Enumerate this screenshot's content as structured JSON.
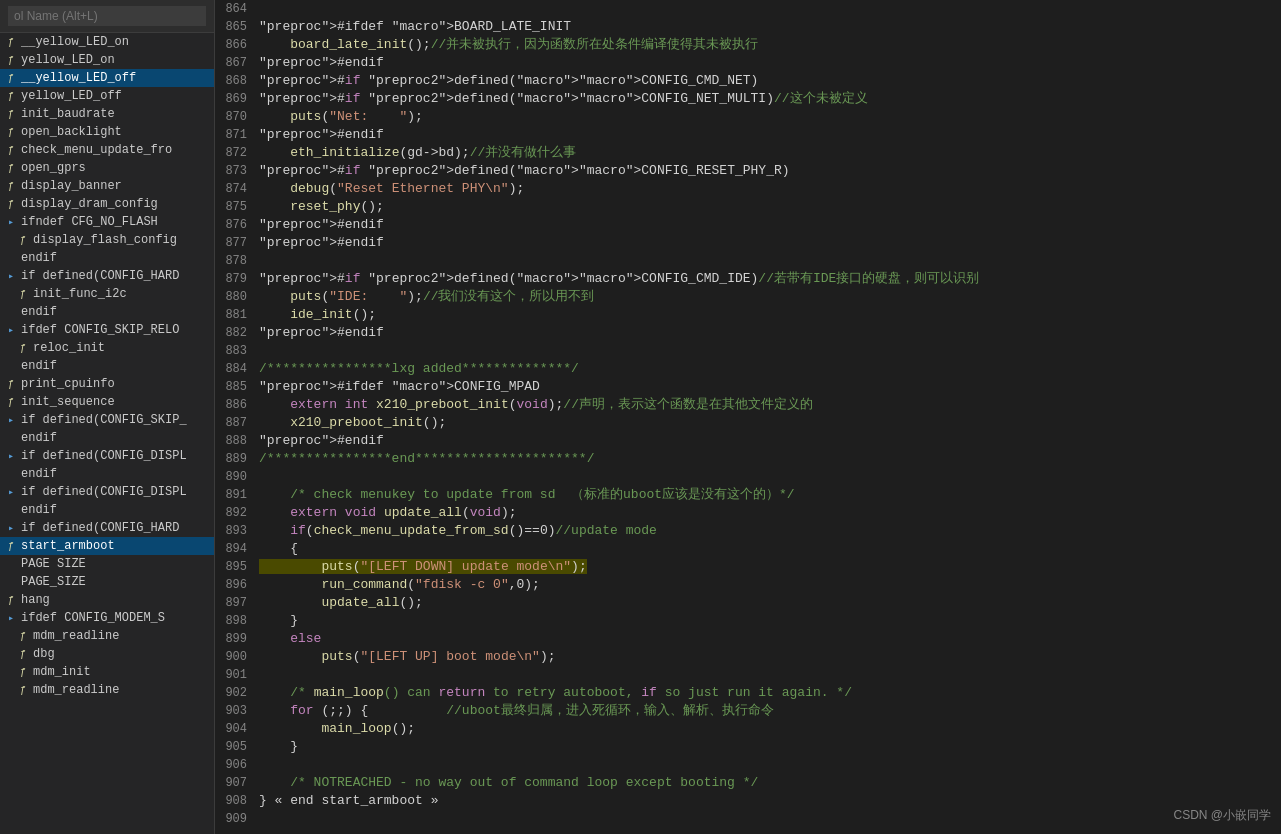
{
  "sidebar": {
    "search_placeholder": "ol Name (Alt+L)",
    "items": [
      {
        "label": "__yellow_LED_on",
        "indent": 0,
        "type": "func",
        "active": false
      },
      {
        "label": "yellow_LED_on",
        "indent": 0,
        "type": "func",
        "active": false
      },
      {
        "label": "__yellow_LED_off",
        "indent": 0,
        "type": "func",
        "active": false,
        "selected": true
      },
      {
        "label": "yellow_LED_off",
        "indent": 0,
        "type": "func",
        "active": false
      },
      {
        "label": "init_baudrate",
        "indent": 0,
        "type": "func",
        "active": false
      },
      {
        "label": "open_backlight",
        "indent": 0,
        "type": "func",
        "active": false
      },
      {
        "label": "check_menu_update_fro",
        "indent": 0,
        "type": "func",
        "active": false
      },
      {
        "label": "open_gprs",
        "indent": 0,
        "type": "func",
        "active": false
      },
      {
        "label": "display_banner",
        "indent": 0,
        "type": "func",
        "active": false
      },
      {
        "label": "display_dram_config",
        "indent": 0,
        "type": "func",
        "active": false
      },
      {
        "label": "ifndef CFG_NO_FLASH",
        "indent": 0,
        "type": "group",
        "active": false
      },
      {
        "label": "display_flash_config",
        "indent": 1,
        "type": "func",
        "active": false
      },
      {
        "label": "endif",
        "indent": 0,
        "type": "kw",
        "active": false
      },
      {
        "label": "if defined(CONFIG_HARD",
        "indent": 0,
        "type": "group",
        "active": false
      },
      {
        "label": "init_func_i2c",
        "indent": 1,
        "type": "func",
        "active": false
      },
      {
        "label": "endif",
        "indent": 0,
        "type": "kw",
        "active": false
      },
      {
        "label": "ifdef CONFIG_SKIP_RELO",
        "indent": 0,
        "type": "group",
        "active": false
      },
      {
        "label": "reloc_init",
        "indent": 1,
        "type": "func",
        "active": false
      },
      {
        "label": "endif",
        "indent": 0,
        "type": "kw",
        "active": false
      },
      {
        "label": "print_cpuinfo",
        "indent": 0,
        "type": "func",
        "active": false
      },
      {
        "label": "init_sequence",
        "indent": 0,
        "type": "func",
        "active": false
      },
      {
        "label": "if defined(CONFIG_SKIP_",
        "indent": 0,
        "type": "group",
        "active": false
      },
      {
        "label": "endif",
        "indent": 0,
        "type": "kw",
        "active": false
      },
      {
        "label": "if defined(CONFIG_DISPL",
        "indent": 0,
        "type": "group",
        "active": false
      },
      {
        "label": "endif",
        "indent": 0,
        "type": "kw",
        "active": false
      },
      {
        "label": "if defined(CONFIG_DISPL",
        "indent": 0,
        "type": "group",
        "active": false
      },
      {
        "label": "endif",
        "indent": 0,
        "type": "kw",
        "active": false
      },
      {
        "label": "if defined(CONFIG_HARD",
        "indent": 0,
        "type": "group",
        "active": false
      },
      {
        "label": "start_armboot",
        "indent": 0,
        "type": "func",
        "active": true
      },
      {
        "label": "PAGE SIZE",
        "indent": 0,
        "type": "kw",
        "active": false
      },
      {
        "label": "PAGE_SIZE",
        "indent": 0,
        "type": "kw",
        "active": false
      },
      {
        "label": "hang",
        "indent": 0,
        "type": "func",
        "active": false
      },
      {
        "label": "ifdef CONFIG_MODEM_S",
        "indent": 0,
        "type": "group",
        "active": false
      },
      {
        "label": "mdm_readline",
        "indent": 1,
        "type": "func",
        "active": false
      },
      {
        "label": "dbg",
        "indent": 1,
        "type": "func",
        "active": false
      },
      {
        "label": "mdm_init",
        "indent": 1,
        "type": "func",
        "active": false
      },
      {
        "label": "mdm_readline",
        "indent": 1,
        "type": "func",
        "active": false
      }
    ]
  },
  "code": {
    "lines": [
      {
        "num": 864,
        "content": ""
      },
      {
        "num": 865,
        "content": "#ifdef BOARD_LATE_INIT",
        "type": "preproc"
      },
      {
        "num": 866,
        "content": "    board_late_init ();//并未被执行，因为函数所在处条件编译使得其未被执行",
        "type": "mixed"
      },
      {
        "num": 867,
        "content": "#endif",
        "type": "preproc"
      },
      {
        "num": 868,
        "content": "#if defined(CONFIG_CMD_NET)",
        "type": "preproc"
      },
      {
        "num": 869,
        "content": "#if defined(CONFIG_NET_MULTI)//这个未被定义",
        "type": "preproc_cmt"
      },
      {
        "num": 870,
        "content": "    puts (\"Net:    \");",
        "type": "code_str"
      },
      {
        "num": 871,
        "content": "#endif",
        "type": "preproc"
      },
      {
        "num": 872,
        "content": "    eth_initialize(gd->bd);//并没有做什么事",
        "type": "code_cmt"
      },
      {
        "num": 873,
        "content": "#if defined(CONFIG_RESET_PHY_R)",
        "type": "preproc"
      },
      {
        "num": 874,
        "content": "    debug (\"Reset Ethernet PHY\\n\");",
        "type": "code_str"
      },
      {
        "num": 875,
        "content": "    reset_phy();",
        "type": "code"
      },
      {
        "num": 876,
        "content": "#endif",
        "type": "preproc"
      },
      {
        "num": 877,
        "content": "#endif",
        "type": "preproc"
      },
      {
        "num": 878,
        "content": ""
      },
      {
        "num": 879,
        "content": "#if defined(CONFIG_CMD_IDE)//若带有IDE接口的硬盘，则可以识别",
        "type": "preproc_cmt"
      },
      {
        "num": 880,
        "content": "    puts(\"IDE:    \");//我们没有这个，所以用不到",
        "type": "code_str_cmt"
      },
      {
        "num": 881,
        "content": "    ide_init();",
        "type": "code"
      },
      {
        "num": 882,
        "content": "#endif",
        "type": "preproc"
      },
      {
        "num": 883,
        "content": ""
      },
      {
        "num": 884,
        "content": "/****************lxg added**************/",
        "type": "comment"
      },
      {
        "num": 885,
        "content": "#ifdef CONFIG_MPAD",
        "type": "preproc"
      },
      {
        "num": 886,
        "content": "    extern int x210_preboot_init(void);//声明，表示这个函数是在其他文件定义的",
        "type": "code_cmt"
      },
      {
        "num": 887,
        "content": "    x210_preboot_init();",
        "type": "code"
      },
      {
        "num": 888,
        "content": "#endif",
        "type": "preproc"
      },
      {
        "num": 889,
        "content": "/****************end**********************/",
        "type": "comment"
      },
      {
        "num": 890,
        "content": ""
      },
      {
        "num": 891,
        "content": "    /* check menukey to update from sd  （标准的uboot应该是没有这个的）*/",
        "type": "comment_inline"
      },
      {
        "num": 892,
        "content": "    extern void update_all(void);",
        "type": "code"
      },
      {
        "num": 893,
        "content": "    if(check_menu_update_from_sd()==0)//update mode",
        "type": "code_cmt"
      },
      {
        "num": 894,
        "content": "    {",
        "type": "code"
      },
      {
        "num": 895,
        "content": "        puts (\"[LEFT DOWN] update mode\\n\");",
        "type": "code_str_hl"
      },
      {
        "num": 896,
        "content": "        run_command(\"fdisk -c 0\",0);",
        "type": "code_str"
      },
      {
        "num": 897,
        "content": "        update_all();",
        "type": "code"
      },
      {
        "num": 898,
        "content": "    }",
        "type": "code"
      },
      {
        "num": 899,
        "content": "    else",
        "type": "code"
      },
      {
        "num": 900,
        "content": "        puts (\"[LEFT UP] boot mode\\n\");",
        "type": "code_str"
      },
      {
        "num": 901,
        "content": ""
      },
      {
        "num": 902,
        "content": "    /* main_loop() can return to retry autoboot, if so just run it again. */",
        "type": "comment"
      },
      {
        "num": 903,
        "content": "    for (;;) {          //uboot最终归属，进入死循环，输入、解析、执行命令",
        "type": "code_cmt"
      },
      {
        "num": 904,
        "content": "        main_loop ();",
        "type": "code"
      },
      {
        "num": 905,
        "content": "    }",
        "type": "code"
      },
      {
        "num": 906,
        "content": ""
      },
      {
        "num": 907,
        "content": "    /* NOTREACHED - no way out of command loop except booting */",
        "type": "comment"
      },
      {
        "num": 908,
        "content": "} « end start_armboot »",
        "type": "code_special"
      },
      {
        "num": 909,
        "content": ""
      }
    ]
  },
  "watermark": "CSDN @小嵌同学"
}
